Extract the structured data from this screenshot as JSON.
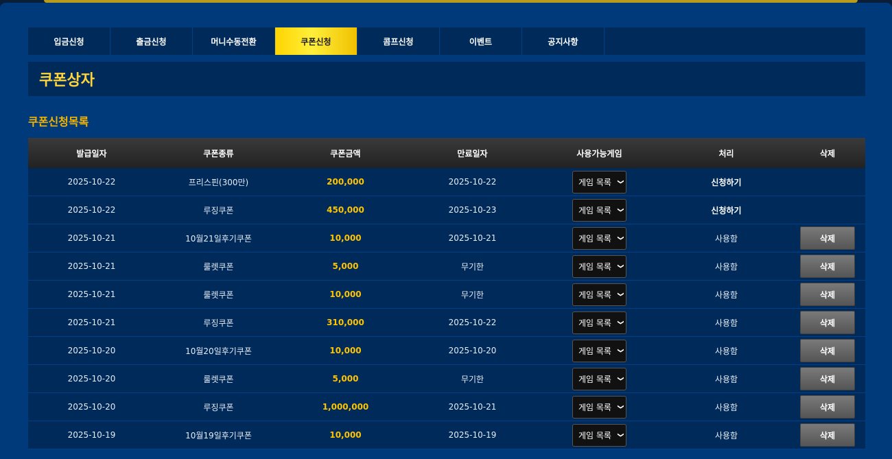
{
  "tabs": [
    "입금신청",
    "출금신청",
    "머니수동전환",
    "쿠폰신청",
    "콤프신청",
    "이벤트",
    "공지사항"
  ],
  "active_tab": 3,
  "page_title": "쿠폰상자",
  "section_title": "쿠폰신청목록",
  "columns": [
    "발급일자",
    "쿠폰종류",
    "쿠폰금액",
    "만료일자",
    "사용가능게임",
    "처리",
    "삭제"
  ],
  "select_label": "게임 목록",
  "delete_label": "삭제",
  "rows": [
    {
      "issue_date": "2025-10-22",
      "type": "프리스핀(300만)",
      "amount": "200,000",
      "expiry": "2025-10-22",
      "status": "신청하기",
      "deletable": false
    },
    {
      "issue_date": "2025-10-22",
      "type": "루징쿠폰",
      "amount": "450,000",
      "expiry": "2025-10-23",
      "status": "신청하기",
      "deletable": false
    },
    {
      "issue_date": "2025-10-21",
      "type": "10월21일후기쿠폰",
      "amount": "10,000",
      "expiry": "2025-10-21",
      "status": "사용함",
      "deletable": true
    },
    {
      "issue_date": "2025-10-21",
      "type": "룰렛쿠폰",
      "amount": "5,000",
      "expiry": "무기한",
      "status": "사용함",
      "deletable": true
    },
    {
      "issue_date": "2025-10-21",
      "type": "룰렛쿠폰",
      "amount": "10,000",
      "expiry": "무기한",
      "status": "사용함",
      "deletable": true
    },
    {
      "issue_date": "2025-10-21",
      "type": "루징쿠폰",
      "amount": "310,000",
      "expiry": "2025-10-22",
      "status": "사용함",
      "deletable": true
    },
    {
      "issue_date": "2025-10-20",
      "type": "10월20일후기쿠폰",
      "amount": "10,000",
      "expiry": "2025-10-20",
      "status": "사용함",
      "deletable": true
    },
    {
      "issue_date": "2025-10-20",
      "type": "룰렛쿠폰",
      "amount": "5,000",
      "expiry": "무기한",
      "status": "사용함",
      "deletable": true
    },
    {
      "issue_date": "2025-10-20",
      "type": "루징쿠폰",
      "amount": "1,000,000",
      "expiry": "2025-10-21",
      "status": "사용함",
      "deletable": true
    },
    {
      "issue_date": "2025-10-19",
      "type": "10월19일후기쿠폰",
      "amount": "10,000",
      "expiry": "2025-10-19",
      "status": "사용함",
      "deletable": true
    }
  ],
  "colors": {
    "accent_gold": "#ffd43a",
    "amount": "#ffc400",
    "panel": "#003a7a",
    "row": "#002a5a"
  }
}
